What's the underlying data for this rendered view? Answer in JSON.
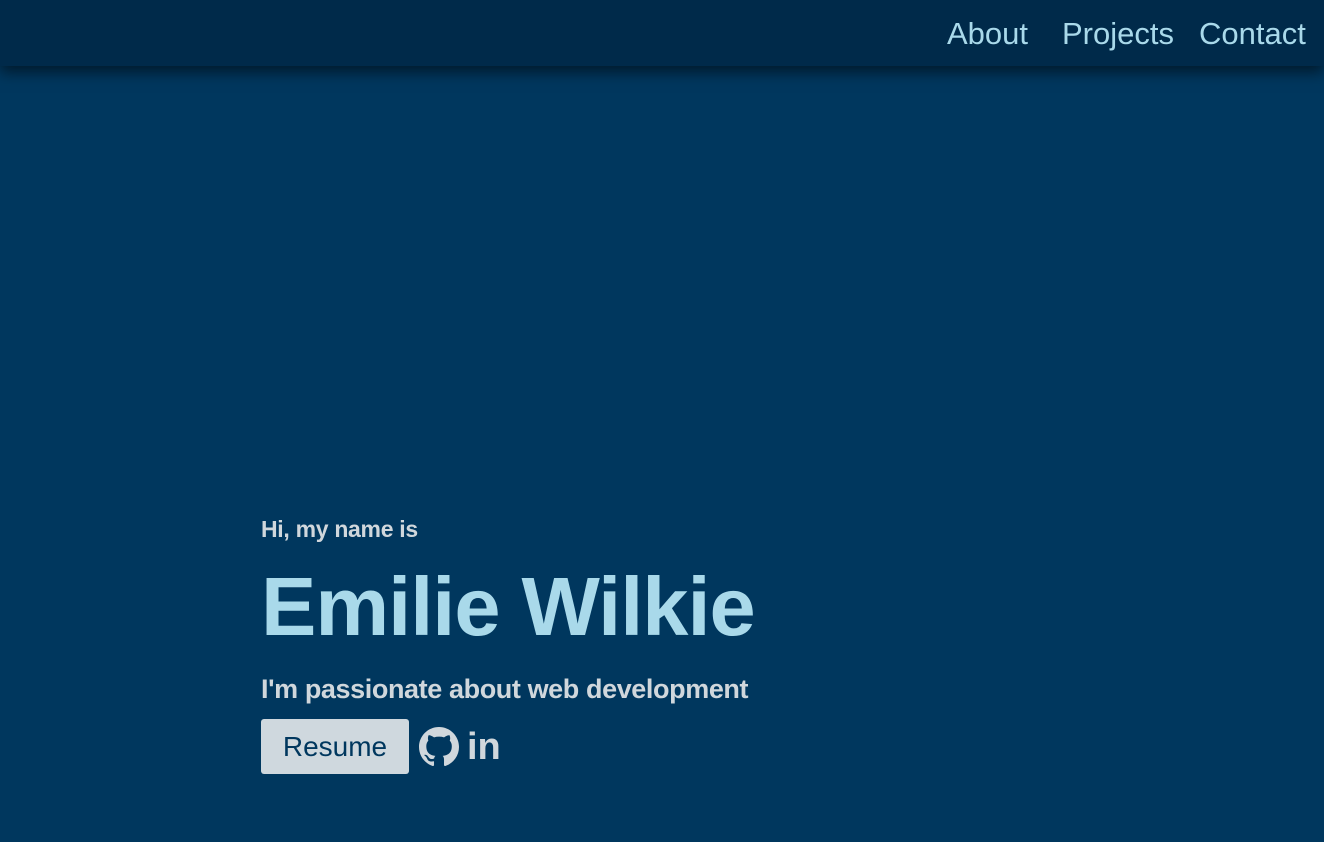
{
  "nav": {
    "items": [
      {
        "label": "About"
      },
      {
        "label": "Projects"
      },
      {
        "label": "Contact"
      }
    ]
  },
  "hero": {
    "greeting": "Hi, my name is",
    "name": "Emilie Wilkie",
    "tagline": "I'm passionate about web development",
    "resume_label": "Resume",
    "social": [
      {
        "icon": "github-icon"
      },
      {
        "icon": "linkedin-icon",
        "glyph": "in"
      }
    ]
  },
  "colors": {
    "background": "#00375e",
    "navbar": "#002a4a",
    "accent": "#a9d9ea",
    "text": "#d0d7dc",
    "button_bg": "#cfd8de"
  }
}
